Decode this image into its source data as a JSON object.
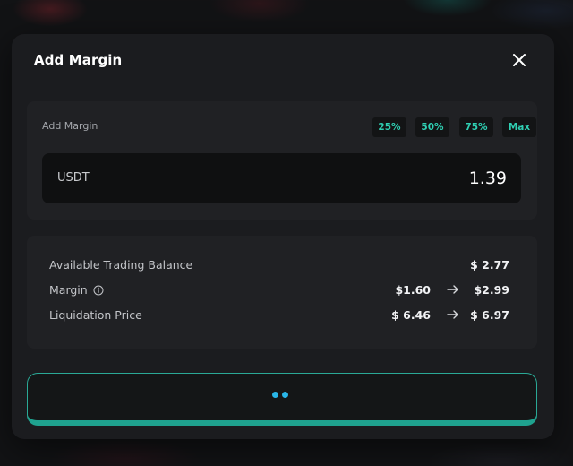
{
  "modal": {
    "title": "Add Margin"
  },
  "input": {
    "label": "Add Margin",
    "percent_options": [
      "25%",
      "50%",
      "75%",
      "Max"
    ],
    "currency": "USDT",
    "amount": "1.39"
  },
  "summary": {
    "available_balance": {
      "label": "Available Trading Balance",
      "value": "$ 2.77"
    },
    "margin": {
      "label": "Margin",
      "from": "$1.60",
      "to": "$2.99"
    },
    "liquidation_price": {
      "label": "Liquidation Price",
      "from": "$ 6.46",
      "to": "$ 6.97"
    }
  },
  "colors": {
    "accent": "#2fd0b3",
    "loader": "#29b6e8",
    "modal_bg": "#1b1c1f",
    "panel_bg": "#202124"
  },
  "icons": {
    "close": "close-icon",
    "info": "info-icon",
    "arrow": "arrow-right-icon"
  }
}
